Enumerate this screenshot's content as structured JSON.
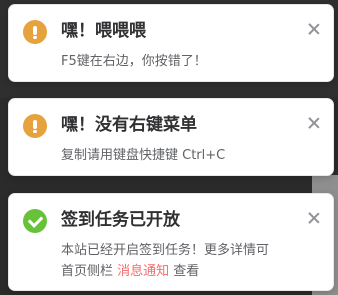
{
  "notifications": [
    {
      "type": "warning",
      "title": "嘿！喂喂喂",
      "body": "F5键在右边，你按错了！"
    },
    {
      "type": "warning",
      "title": "嘿！没有右键菜单",
      "body": "复制请用键盘快捷键 Ctrl+C"
    },
    {
      "type": "success",
      "title": "签到任务已开放",
      "body_line1": "本站已经开启签到任务！更多详情可",
      "body_line2_pre": "首页侧栏 ",
      "body_line2_link": "消息通知",
      "body_line2_post": " 查看"
    }
  ],
  "icons": {
    "warning": "warning-icon",
    "success": "check-circle-icon",
    "close": "close-icon"
  },
  "colors": {
    "warning": "#e6a23c",
    "success": "#67c23a",
    "highlight": "#f56c6c",
    "title": "#303133",
    "text": "#606266"
  }
}
